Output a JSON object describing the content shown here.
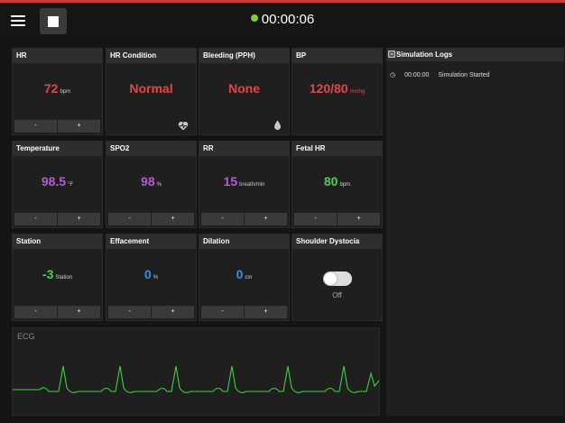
{
  "topbar": {
    "timer": "00:00:06",
    "timer_status_color": "#7ed321"
  },
  "vitals": {
    "hr": {
      "label": "HR",
      "value": "72",
      "unit": "bpm",
      "color": "#e04848",
      "minus": "-",
      "plus": "+"
    },
    "hr_condition": {
      "label": "HR Condition",
      "value": "Normal",
      "color": "#e04848",
      "icon": "heart-pulse-icon"
    },
    "bleeding": {
      "label": "Bleeding (PPH)",
      "value": "None",
      "color": "#e04848",
      "icon": "blood-drop-icon"
    },
    "bp": {
      "label": "BP",
      "value": "120/80",
      "unit": "mmhg",
      "color": "#e04848"
    },
    "temperature": {
      "label": "Temperature",
      "value": "98.5",
      "unit": "°F",
      "color": "#b65bd6",
      "minus": "-",
      "plus": "+"
    },
    "spo2": {
      "label": "SPO2",
      "value": "98",
      "unit": "%",
      "color": "#b65bd6",
      "minus": "-",
      "plus": "+"
    },
    "rr": {
      "label": "RR",
      "value": "15",
      "unit": "breath/min",
      "color": "#b65bd6",
      "minus": "-",
      "plus": "+"
    },
    "fetal_hr": {
      "label": "Fetal HR",
      "value": "80",
      "unit": "bpm",
      "color": "#4bd04b",
      "minus": "-",
      "plus": "+"
    },
    "station": {
      "label": "Station",
      "value": "-3",
      "unit": "Station",
      "color": "#4bd04b",
      "minus": "-",
      "plus": "+"
    },
    "effacement": {
      "label": "Effacement",
      "value": "0",
      "unit": "%",
      "color": "#2f8ff0",
      "minus": "-",
      "plus": "+"
    },
    "dilation": {
      "label": "Dilation",
      "value": "0",
      "unit": "cm",
      "color": "#2f8ff0",
      "minus": "-",
      "plus": "+"
    },
    "shoulder": {
      "label": "Shoulder Dystocia",
      "state": "Off"
    }
  },
  "ecg": {
    "title": "ECG",
    "trace_color": "#3fd03f"
  },
  "logs": {
    "title": "Simulation Logs",
    "entries": [
      {
        "time": "00:00:00",
        "message": "Simulation Started"
      }
    ]
  }
}
